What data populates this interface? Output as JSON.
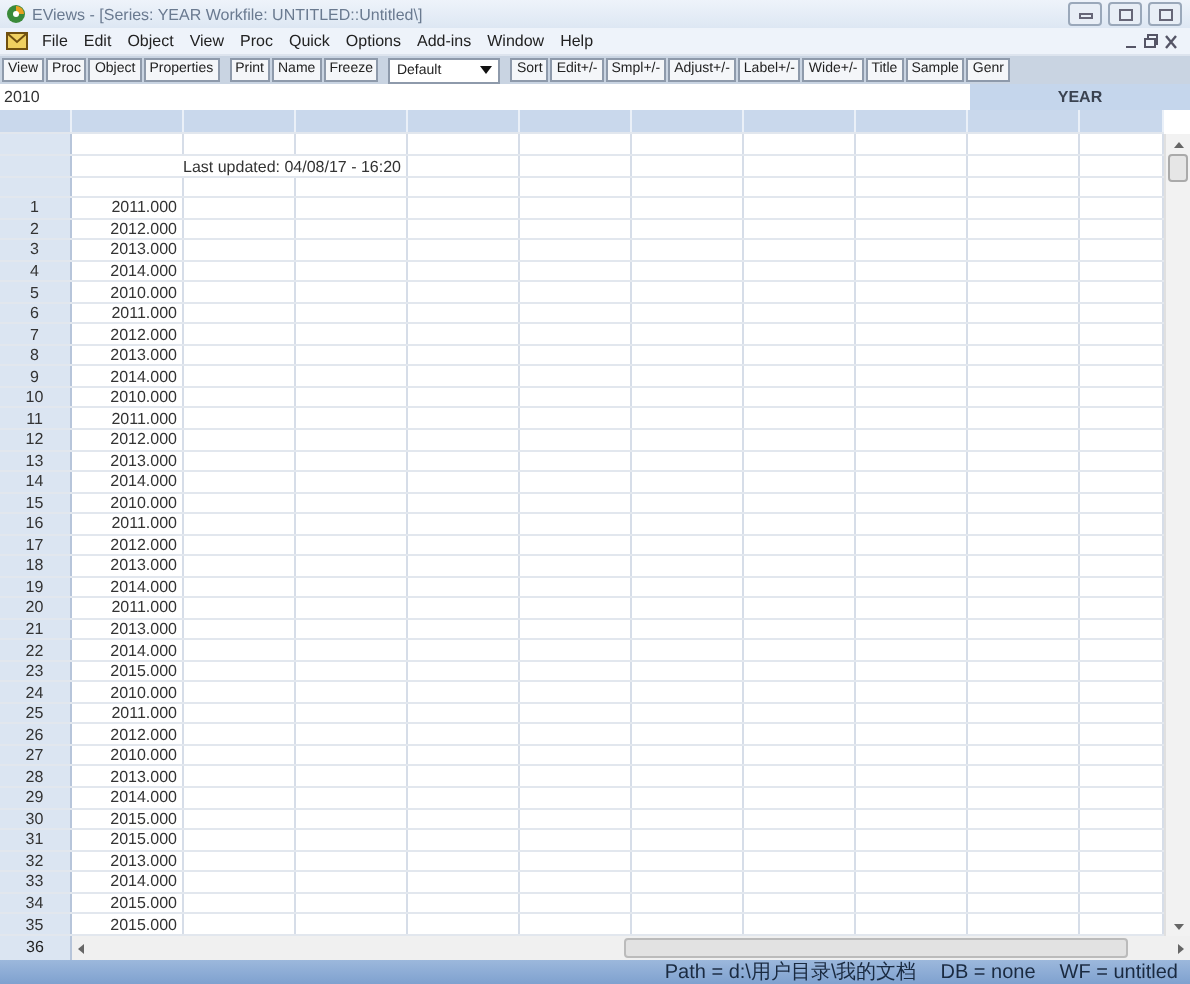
{
  "window": {
    "title": "EViews - [Series: YEAR   Workfile: UNTITLED::Untitled\\]"
  },
  "menu": [
    "File",
    "Edit",
    "Object",
    "View",
    "Proc",
    "Quick",
    "Options",
    "Add-ins",
    "Window",
    "Help"
  ],
  "toolbar": [
    {
      "kind": "button",
      "label": "View"
    },
    {
      "kind": "button",
      "label": "Proc"
    },
    {
      "kind": "button",
      "label": "Object"
    },
    {
      "kind": "button",
      "label": "Properties"
    },
    {
      "kind": "separator"
    },
    {
      "kind": "button",
      "label": "Print"
    },
    {
      "kind": "button",
      "label": "Name"
    },
    {
      "kind": "button",
      "label": "Freeze"
    },
    {
      "kind": "separator"
    },
    {
      "kind": "dropdown",
      "label": "Default"
    },
    {
      "kind": "separator"
    },
    {
      "kind": "button",
      "label": "Sort"
    },
    {
      "kind": "button",
      "label": "Edit+/-"
    },
    {
      "kind": "button",
      "label": "Smpl+/-"
    },
    {
      "kind": "button",
      "label": "Adjust+/-"
    },
    {
      "kind": "button",
      "label": "Label+/-"
    },
    {
      "kind": "button",
      "label": "Wide+/-"
    },
    {
      "kind": "button",
      "label": "Title"
    },
    {
      "kind": "button",
      "label": "Sample"
    },
    {
      "kind": "button",
      "label": "Genr"
    }
  ],
  "edit_line": {
    "value": "2010"
  },
  "series_name": "YEAR",
  "grid": {
    "note": "Last updated: 04/08/17 - 16:20",
    "rows": [
      {
        "number": "1",
        "value": "2011.000"
      },
      {
        "number": "2",
        "value": "2012.000"
      },
      {
        "number": "3",
        "value": "2013.000"
      },
      {
        "number": "4",
        "value": "2014.000"
      },
      {
        "number": "5",
        "value": "2010.000"
      },
      {
        "number": "6",
        "value": "2011.000"
      },
      {
        "number": "7",
        "value": "2012.000"
      },
      {
        "number": "8",
        "value": "2013.000"
      },
      {
        "number": "9",
        "value": "2014.000"
      },
      {
        "number": "10",
        "value": "2010.000"
      },
      {
        "number": "11",
        "value": "2011.000"
      },
      {
        "number": "12",
        "value": "2012.000"
      },
      {
        "number": "13",
        "value": "2013.000"
      },
      {
        "number": "14",
        "value": "2014.000"
      },
      {
        "number": "15",
        "value": "2010.000"
      },
      {
        "number": "16",
        "value": "2011.000"
      },
      {
        "number": "17",
        "value": "2012.000"
      },
      {
        "number": "18",
        "value": "2013.000"
      },
      {
        "number": "19",
        "value": "2014.000"
      },
      {
        "number": "20",
        "value": "2011.000"
      },
      {
        "number": "21",
        "value": "2013.000"
      },
      {
        "number": "22",
        "value": "2014.000"
      },
      {
        "number": "23",
        "value": "2015.000"
      },
      {
        "number": "24",
        "value": "2010.000"
      },
      {
        "number": "25",
        "value": "2011.000"
      },
      {
        "number": "26",
        "value": "2012.000"
      },
      {
        "number": "27",
        "value": "2010.000"
      },
      {
        "number": "28",
        "value": "2013.000"
      },
      {
        "number": "29",
        "value": "2014.000"
      },
      {
        "number": "30",
        "value": "2015.000"
      },
      {
        "number": "31",
        "value": "2015.000"
      },
      {
        "number": "32",
        "value": "2013.000"
      },
      {
        "number": "33",
        "value": "2014.000"
      },
      {
        "number": "34",
        "value": "2015.000"
      },
      {
        "number": "35",
        "value": "2015.000"
      }
    ],
    "last_row_number": "36"
  },
  "status_bar": [
    "Path = d:\\用户目录\\我的文档",
    "DB = none",
    "WF = untitled"
  ]
}
